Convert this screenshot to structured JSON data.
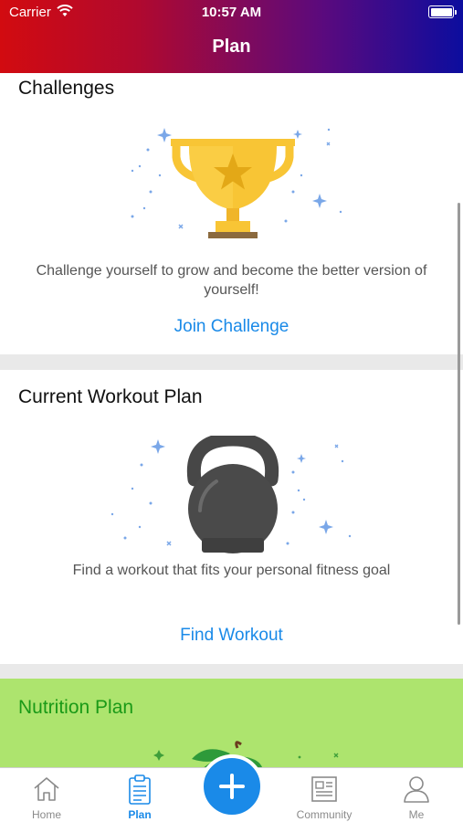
{
  "status_bar": {
    "carrier": "Carrier",
    "time": "10:57 AM"
  },
  "nav": {
    "title": "Plan"
  },
  "cards": {
    "challenges": {
      "title": "Challenges",
      "description": "Challenge yourself to grow and become the better version of yourself!",
      "action": "Join Challenge",
      "illustration_icon": "trophy-icon"
    },
    "workout": {
      "title": "Current Workout Plan",
      "description": "Find a workout that fits your personal fitness goal",
      "action": "Find Workout",
      "illustration_icon": "kettlebell-icon"
    },
    "nutrition": {
      "title": "Nutrition Plan",
      "illustration_icon": "apple-icon"
    }
  },
  "tabbar": {
    "tabs": [
      {
        "label": "Home",
        "icon": "home-icon"
      },
      {
        "label": "Plan",
        "icon": "clipboard-icon",
        "active": true
      },
      {
        "label": "Community",
        "icon": "newspaper-icon"
      },
      {
        "label": "Me",
        "icon": "person-icon"
      }
    ],
    "center_icon": "plus-icon"
  },
  "colors": {
    "accent": "#1a8ae8",
    "header_gradient_start": "#d20b10",
    "header_gradient_end": "#0c0d9e",
    "nutrition_bg": "#ade46e",
    "nutrition_title": "#1a9a17",
    "trophy": "#f8c535",
    "kettlebell": "#4a4a4a"
  }
}
